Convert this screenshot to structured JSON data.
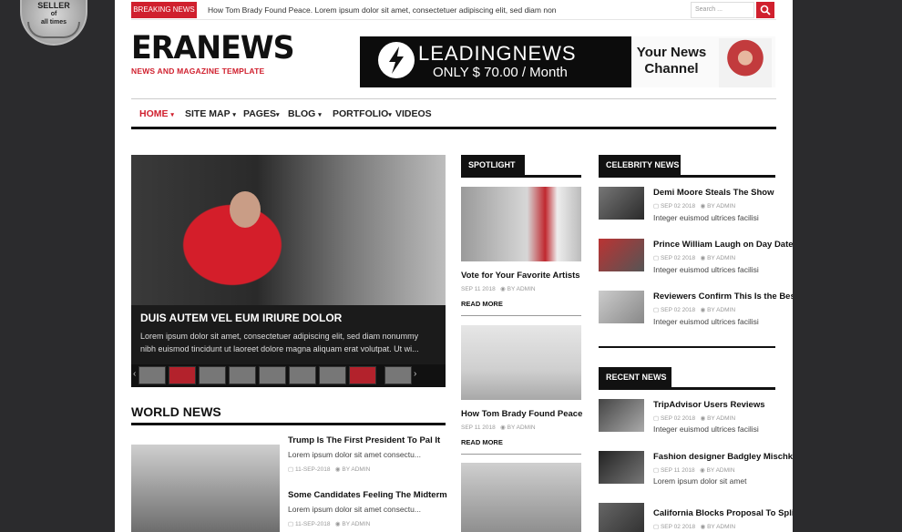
{
  "badge": {
    "line1": "SELLER",
    "line2": "of",
    "line3": "all times"
  },
  "topbar": {
    "breaking_label": "BREAKING NEWS",
    "breaking_text": "How Tom Brady Found Peace. Lorem ipsum dolor sit amet, consectetuer adipiscing elit, sed diam non",
    "search_placeholder": "Search ..."
  },
  "brand": {
    "logo": "ERANEWS",
    "tagline": "NEWS AND MAGAZINE TEMPLATE"
  },
  "ad": {
    "title": "LEADINGNEWS",
    "price": "ONLY $ 70.00 / Month",
    "channel": "Your News Channel"
  },
  "nav": [
    {
      "label": "HOME",
      "caret": "▾"
    },
    {
      "label": "SITE MAP",
      "caret": "▾"
    },
    {
      "label": "PAGES",
      "caret": "▾"
    },
    {
      "label": "BLOG",
      "caret": "▾"
    },
    {
      "label": "PORTFOLIO",
      "caret": "▾"
    },
    {
      "label": "VIDEOS",
      "caret": ""
    }
  ],
  "hero": {
    "title": "DUIS AUTEM VEL EUM IRIURE DOLOR",
    "excerpt": "Lorem ipsum dolor sit amet, consectetuer adipiscing elit, sed diam nonummy nibh euismod tincidunt ut laoreet dolore magna aliquam erat volutpat. Ut wi...",
    "prev": "‹",
    "next": "›"
  },
  "world": {
    "heading": "WORLD NEWS",
    "items": [
      {
        "title": "Trump Is The First President To Pal It",
        "excerpt": "Lorem ipsum dolor sit amet consectu...",
        "date": "11-SEP-2018",
        "author": "BY ADMIN"
      },
      {
        "title": "Some Candidates Feeling The Midterm",
        "excerpt": "Lorem ipsum dolor sit amet consectu...",
        "date": "11-SEP-2018",
        "author": "BY ADMIN"
      }
    ]
  },
  "spotlight": {
    "heading": "SPOTLIGHT",
    "items": [
      {
        "title": "Vote for Your Favorite Artists",
        "date": "SEP 11 2018",
        "author": "BY ADMIN",
        "read_more": "READ MORE"
      },
      {
        "title": "How Tom Brady Found Peace",
        "date": "SEP 11 2018",
        "author": "BY ADMIN",
        "read_more": "READ MORE"
      }
    ]
  },
  "celebrity": {
    "heading": "CELEBRITY NEWS",
    "items": [
      {
        "title": "Demi Moore Steals The Show",
        "date": "SEP 02 2018",
        "author": "BY ADMIN",
        "excerpt": "Integer euismod ultrices facilisi"
      },
      {
        "title": "Prince William Laugh on Day Date",
        "date": "SEP 02 2018",
        "author": "BY ADMIN",
        "excerpt": "Integer euismod ultrices facilisi"
      },
      {
        "title": "Reviewers Confirm This Is the Best",
        "date": "SEP 02 2018",
        "author": "BY ADMIN",
        "excerpt": "Integer euismod ultrices facilisi"
      }
    ]
  },
  "recent": {
    "heading": "RECENT NEWS",
    "items": [
      {
        "title": "TripAdvisor Users Reviews",
        "date": "SEP 02 2018",
        "author": "BY ADMIN",
        "excerpt": "Integer euismod ultrices facilisi"
      },
      {
        "title": "Fashion designer Badgley Mischka",
        "date": "SEP 11 2018",
        "author": "BY ADMIN",
        "excerpt": "Lorem ipsum dolor sit amet"
      },
      {
        "title": "California Blocks Proposal To Split",
        "date": "SEP 02 2018",
        "author": "BY ADMIN",
        "excerpt": ""
      }
    ]
  },
  "colors": {
    "accent": "#d0202e",
    "dark": "#111111",
    "frame": "#2b2b2d"
  }
}
